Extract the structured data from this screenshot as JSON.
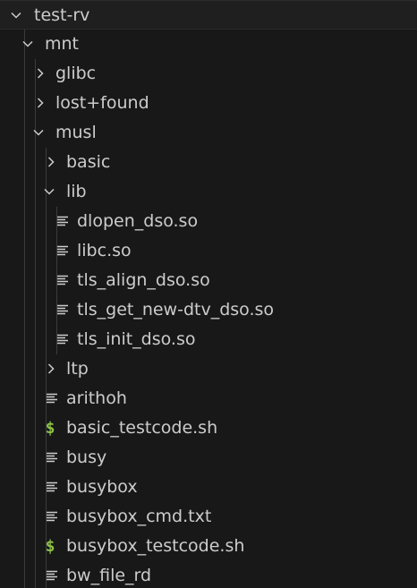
{
  "tree": {
    "root": "test-rv",
    "mnt": "mnt",
    "glibc": "glibc",
    "lost_found": "lost+found",
    "musl": "musl",
    "basic": "basic",
    "lib": "lib",
    "lib_files": [
      "dlopen_dso.so",
      "libc.so",
      "tls_align_dso.so",
      "tls_get_new-dtv_dso.so",
      "tls_init_dso.so"
    ],
    "ltp": "ltp",
    "musl_files": [
      {
        "name": "arithoh",
        "icon": "file-lines-icon"
      },
      {
        "name": "basic_testcode.sh",
        "icon": "shell-script-icon"
      },
      {
        "name": "busy",
        "icon": "file-lines-icon"
      },
      {
        "name": "busybox",
        "icon": "file-lines-icon"
      },
      {
        "name": "busybox_cmd.txt",
        "icon": "file-lines-icon"
      },
      {
        "name": "busybox_testcode.sh",
        "icon": "shell-script-icon"
      },
      {
        "name": "bw_file_rd",
        "icon": "file-lines-icon"
      }
    ],
    "shell_icon_glyph": "$",
    "colors": {
      "background": "#181818",
      "text": "#cccccc",
      "shell_icon": "#8dc149",
      "indent_guide": "#3c3c3c"
    }
  }
}
